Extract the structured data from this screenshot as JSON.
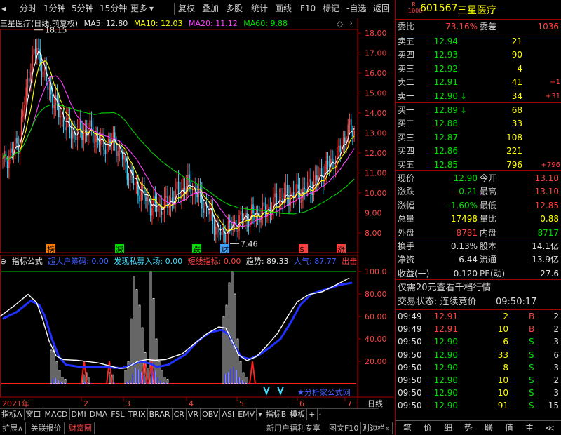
{
  "toolbar": {
    "items": [
      "分时",
      "1分钟",
      "5分钟",
      "15分钟",
      "更多",
      "复权",
      "叠加",
      "多股",
      "统计",
      "画线",
      "F10",
      "标记",
      "-自选",
      "返回"
    ]
  },
  "main_legend": {
    "title": "三星医疗(日线,前复权)",
    "ma5": "MA5: 12.80",
    "ma10": "MA10: 12.03",
    "ma20": "MA20: 11.12",
    "ma60": "MA60: 9.88"
  },
  "price_axis": [
    "18.00",
    "17.00",
    "16.00",
    "15.00",
    "14.00",
    "13.00",
    "12.00",
    "11.00",
    "10.00",
    "9.00",
    "8.00"
  ],
  "annotations": {
    "high": "18.15",
    "low": "7.46"
  },
  "event_markers": [
    "榜",
    "减",
    "跌",
    "财",
    "$",
    "涨"
  ],
  "indicator_legend": {
    "name": "指标公式",
    "big_money": "超大户筹码: 0.00",
    "private_fund": "发现私募入场: 0.00",
    "short_line": "短线指标: 0.00",
    "trend": "趋势: 89.33",
    "popularity": "人气: 87.77",
    "exit": "出击"
  },
  "indicator_axis": [
    "100.0",
    "80.00",
    "60.00",
    "40.00",
    "20.00"
  ],
  "indicator_watermark": "★分析家公式网",
  "date_axis": {
    "year": "2021年",
    "months": [
      "2",
      "3",
      "4",
      "5",
      "6",
      "7"
    ],
    "period": "日线"
  },
  "bottom_tabs": [
    "指标A",
    "窗口",
    "MACD",
    "DMI",
    "DMA",
    "FSL",
    "TRIX",
    "BRAR",
    "CR",
    "VR",
    "OBV",
    "ASI",
    "EMV",
    "▾",
    "指标B",
    "模板",
    "+",
    "-"
  ],
  "status_bar": [
    "扩展∧",
    "关联报价",
    "财富圈",
    "新用户福利专享",
    "图文F10",
    "则边栏«"
  ],
  "right_panel": {
    "code": "601567",
    "name": "三星医疗",
    "badge_top": "R",
    "badge_bottom": "1000",
    "webi_label": "委比",
    "webi_value": "73.16%",
    "wecha_label": "委差",
    "wecha_value": "1036",
    "asks": [
      {
        "label": "卖五",
        "price": "12.94",
        "vol": "21",
        "chg": ""
      },
      {
        "label": "卖四",
        "price": "12.93",
        "vol": "90",
        "chg": ""
      },
      {
        "label": "卖三",
        "price": "12.92",
        "vol": "4",
        "chg": ""
      },
      {
        "label": "卖二",
        "price": "12.91",
        "vol": "41",
        "chg": "+1"
      },
      {
        "label": "卖一",
        "price": "12.90",
        "vol": "34",
        "chg": "+31",
        "arrow": "↓"
      }
    ],
    "bids": [
      {
        "label": "买一",
        "price": "12.89",
        "vol": "68",
        "chg": "",
        "arrow": "↓"
      },
      {
        "label": "买二",
        "price": "12.88",
        "vol": "33",
        "chg": ""
      },
      {
        "label": "买三",
        "price": "12.87",
        "vol": "108",
        "chg": ""
      },
      {
        "label": "买四",
        "price": "12.86",
        "vol": "221",
        "chg": ""
      },
      {
        "label": "买五",
        "price": "12.85",
        "vol": "796",
        "chg": "+796"
      }
    ],
    "stats": [
      {
        "l1": "现价",
        "v1": "12.90",
        "l2": "今开",
        "v2": "13.10"
      },
      {
        "l1": "涨跌",
        "v1": "-0.21",
        "l2": "最高",
        "v2": "13.10"
      },
      {
        "l1": "涨幅",
        "v1": "-1.60%",
        "l2": "最低",
        "v2": "12.85"
      },
      {
        "l1": "总量",
        "v1": "17498",
        "l2": "量比",
        "v2": "0.88"
      },
      {
        "l1": "外盘",
        "v1": "8781",
        "l2": "内盘",
        "v2": "8717"
      }
    ],
    "stats2": [
      {
        "l1": "换手",
        "v1": "0.13%",
        "l2": "股本",
        "v2": "14.1亿"
      },
      {
        "l1": "净资",
        "v1": "6.44",
        "l2": "流通",
        "v2": "13.9亿"
      },
      {
        "l1": "收益(一)",
        "v1": "0.120",
        "l2": "PE(动)",
        "v2": "27.6"
      }
    ],
    "promo": "仅需20元查看千档行情",
    "trade_status": "交易状态: 连续竞价",
    "trade_time": "09:50:17",
    "ticks": [
      {
        "time": "09:49",
        "price": "12.91",
        "vol": "2",
        "side": "B",
        "n": "2"
      },
      {
        "time": "09:49",
        "price": "12.91",
        "vol": "10",
        "side": "B",
        "n": "2"
      },
      {
        "time": "09:50",
        "price": "12.90",
        "vol": "6",
        "side": "S",
        "n": "3"
      },
      {
        "time": "09:50",
        "price": "12.90",
        "vol": "33",
        "side": "S",
        "n": "6"
      },
      {
        "time": "09:50",
        "price": "12.90",
        "vol": "8",
        "side": "S",
        "n": "3"
      },
      {
        "time": "09:50",
        "price": "12.90",
        "vol": "10",
        "side": "S",
        "n": "2"
      },
      {
        "time": "09:50",
        "price": "12.90",
        "vol": "10",
        "side": "S",
        "n": "3"
      },
      {
        "time": "09:50",
        "price": "12.90",
        "vol": "91",
        "side": "S",
        "n": "15"
      }
    ],
    "tabs": [
      "笔",
      "价",
      "细",
      "势",
      "联",
      "值",
      "主",
      "≪"
    ]
  },
  "colors": {
    "up": "#ff4040",
    "down": "#00e000",
    "ma5": "#ffffff",
    "ma10": "#ffff00",
    "ma20": "#ff40ff",
    "ma60": "#00d000"
  }
}
